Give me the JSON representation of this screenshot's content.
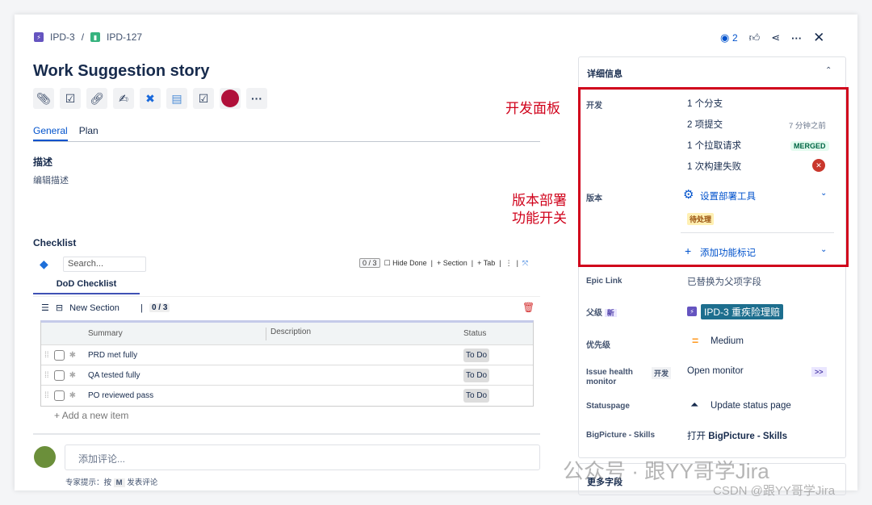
{
  "breadcrumb": {
    "parent": "IPD-3",
    "separator": "/",
    "current": "IPD-127"
  },
  "header": {
    "watch_count": "2",
    "icons": [
      "eye-icon",
      "like-icon",
      "share-icon",
      "more-icon",
      "close-icon"
    ]
  },
  "title": "Work Suggestion story",
  "toolbar_icons": [
    "attachment-icon",
    "subtask-icon",
    "link-icon",
    "sign-icon",
    "confluence-icon",
    "document-icon",
    "checkbox-icon",
    "red-app-icon",
    "more-icon"
  ],
  "tabs": [
    "General",
    "Plan"
  ],
  "description": {
    "heading": "描述",
    "placeholder": "编辑描述"
  },
  "checklist": {
    "heading": "Checklist",
    "search_placeholder": "Search...",
    "progress": "0 / 3",
    "hide_done": "Hide Done",
    "section_btn": "Section",
    "tab_btn": "Tab",
    "tab_name": "DoD Checklist",
    "section_name": "New Section",
    "section_progress": "0 / 3",
    "columns": [
      "Summary",
      "Description",
      "Status"
    ],
    "items": [
      {
        "summary": "PRD met fully",
        "description": "",
        "status": "To Do"
      },
      {
        "summary": "QA tested fully",
        "description": "",
        "status": "To Do"
      },
      {
        "summary": "PO reviewed pass",
        "description": "",
        "status": "To Do"
      }
    ],
    "add_item": "Add a new item"
  },
  "comment": {
    "placeholder": "添加评论...",
    "tip_prefix": "专家提示：按",
    "tip_key": "M",
    "tip_suffix": "发表评论"
  },
  "details": {
    "heading": "详细信息",
    "dev_label": "开发",
    "branches": "1 个分支",
    "commits": "2 项提交",
    "commits_time": "7 分钟之前",
    "pull_requests": "1 个拉取请求",
    "pr_status": "MERGED",
    "builds": "1 次构建失败",
    "release_label": "版本",
    "deploy_tool": "设置部署工具",
    "pending": "待处理",
    "add_flag": "添加功能标记",
    "epic_label": "Epic Link",
    "epic_value": "已替换为父项字段",
    "parent_label": "父级",
    "parent_badge": "新",
    "parent_value": "IPD-3 重疾险理赔",
    "priority_label": "优先级",
    "priority_value": "Medium",
    "health_label": "Issue health monitor",
    "health_badge": "开发",
    "health_value": "Open monitor",
    "health_btn": ">>",
    "status_label": "Statuspage",
    "status_value": "Update status page",
    "bp_label": "BigPicture - Skills",
    "bp_prefix": "打开",
    "bp_value": "BigPicture - Skills",
    "more_fields": "更多字段"
  },
  "annotations": {
    "dev_panel": "开发面板",
    "release_line1": "版本部署",
    "release_line2": "功能开关"
  },
  "watermark": {
    "line1": "公众号 · 跟YY哥学Jira",
    "line2": "CSDN @跟YY哥学Jira"
  },
  "colors": {
    "accent": "#0052cc",
    "annotation": "#d0021b",
    "epic": "#6554c0",
    "story": "#36b37e",
    "parent_chip": "#1d6e8e"
  }
}
